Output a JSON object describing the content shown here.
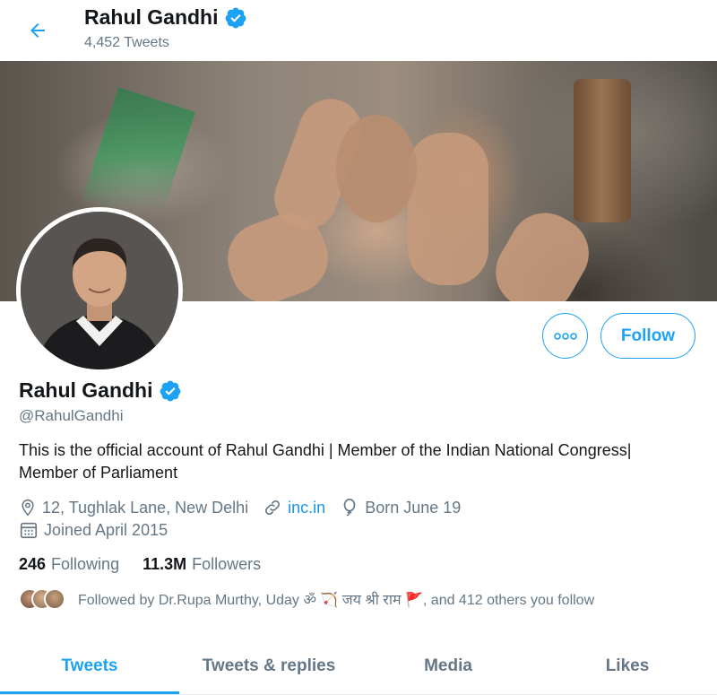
{
  "header": {
    "back_icon": "arrow-left-icon",
    "name": "Rahul Gandhi",
    "tweet_count": "4,452 Tweets",
    "verified_icon": "verified-badge-icon"
  },
  "profile": {
    "name": "Rahul Gandhi",
    "handle": "@RahulGandhi",
    "bio": "This is the official account of Rahul Gandhi | Member of the Indian National Congress| Member of Parliament",
    "location": "12, Tughlak Lane, New Delhi",
    "website": "inc.in",
    "birthday": "Born June 19",
    "joined": "Joined April 2015",
    "following_count": "246",
    "following_label": "Following",
    "followers_count": "11.3M",
    "followers_label": "Followers",
    "followed_by": "Followed by Dr.Rupa Murthy, Uday ॐ 🏹 जय श्री राम 🚩, and 412 others you follow"
  },
  "actions": {
    "more_icon": "more-options-icon",
    "follow_label": "Follow"
  },
  "tabs": [
    {
      "label": "Tweets",
      "active": true
    },
    {
      "label": "Tweets & replies",
      "active": false
    },
    {
      "label": "Media",
      "active": false
    },
    {
      "label": "Likes",
      "active": false
    }
  ],
  "colors": {
    "accent": "#1da1f2",
    "secondary_text": "#657786",
    "link": "#1b95e0"
  }
}
